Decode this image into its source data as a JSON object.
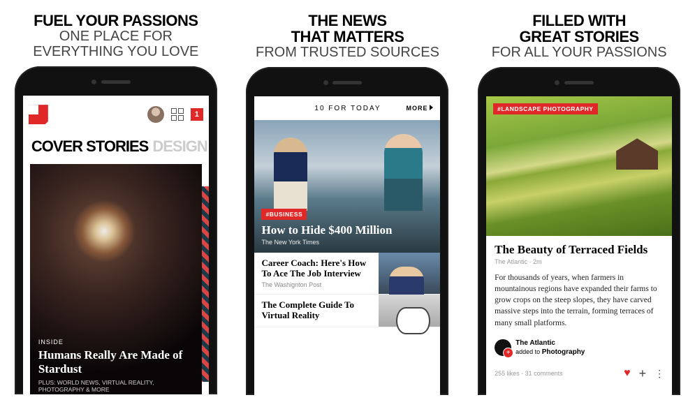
{
  "columns": [
    {
      "head_bold": [
        "FUEL YOUR PASSIONS"
      ],
      "head_light": [
        "ONE PLACE FOR",
        "EVERYTHING YOU LOVE"
      ]
    },
    {
      "head_bold": [
        "THE NEWS",
        "THAT MATTERS"
      ],
      "head_light": [
        "FROM TRUSTED SOURCES"
      ]
    },
    {
      "head_bold": [
        "FILLED WITH",
        "GREAT STORIES"
      ],
      "head_light": [
        "FOR ALL YOUR PASSIONS"
      ]
    }
  ],
  "screen1": {
    "notif_count": "1",
    "tabs": {
      "active": "COVER STORIES",
      "inactive": "DESIGN TECH"
    },
    "article": {
      "kicker": "INSIDE",
      "title": "Humans Really Are Made of Stardust",
      "sub": "PLUS: WORLD NEWS, VIRTUAL REALITY, PHOTOGRAPHY & MORE"
    }
  },
  "screen2": {
    "header": "10 FOR TODAY",
    "more": "MORE",
    "feature": {
      "tag": "#BUSINESS",
      "title": "How to Hide $400 Million",
      "source": "The New York Times"
    },
    "rows": [
      {
        "title": "Career Coach: Here's How To Ace The Job Interview",
        "source": "The Washignton Post"
      },
      {
        "title": "The Complete Guide To Virtual Reality",
        "source": ""
      }
    ]
  },
  "screen3": {
    "tag": "#LANDSCAPE PHOTOGRAPHY",
    "title": "The Beauty of Terraced Fields",
    "meta": "The Atlantic · 2m",
    "body": "For thousands of years, when farmers in mountainous regions have expanded their farms to grow crops on the steep slopes, they have carved massive steps into the terrain, forming terraces of many small platforms.",
    "author_name": "The Atlantic",
    "author_action": "added to",
    "author_mag": "Photography",
    "stats": "255 likes · 31 comments"
  }
}
